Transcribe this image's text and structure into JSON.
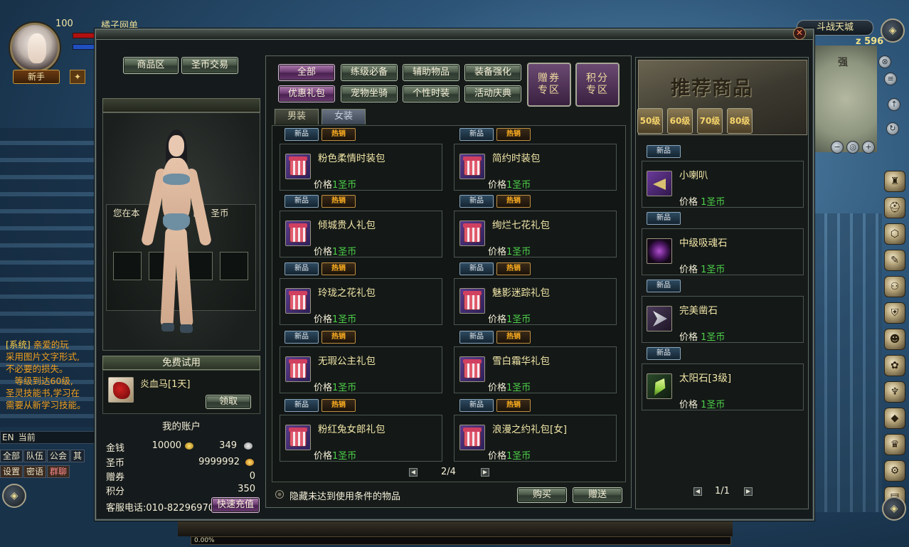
{
  "hud": {
    "level": "100",
    "player_name": "橘子网单",
    "rank_badge": "新手",
    "map_name": "斗战天城",
    "map_coord": "z 596",
    "map_marker": "强",
    "exp_percent": "0.00%"
  },
  "chat": {
    "tag": "系统",
    "lines": [
      "亲爱的玩",
      "采用图片文字形式,",
      "不必要的损失。",
      "　等级到达60级,",
      "圣灵技能书,学习在",
      "需要从新学习技能。"
    ],
    "input_mode": "EN",
    "input_label": "当前",
    "tabs_row1": [
      "全部",
      "队伍",
      "公会",
      "其"
    ],
    "tabs_row2": [
      "设置",
      "密语",
      "群聊"
    ]
  },
  "shop": {
    "left_tabs": [
      "商品区",
      "圣币交易"
    ],
    "notice_text": "您在本　　　　　　的　圣币",
    "free_trial": {
      "title": "免费试用",
      "item_name": "炎血马[1天]",
      "claim_button": "领取"
    },
    "account": {
      "title": "我的账户",
      "gold_label": "金钱",
      "gold_value": "10000",
      "silver_value": "349",
      "coin_label": "圣币",
      "coin_value": "9999992",
      "voucher_label": "赠券",
      "voucher_value": "0",
      "points_label": "积分",
      "points_value": "350",
      "hotline": "客服电话:010-82296970",
      "recharge_button": "快速充值"
    },
    "categories": [
      "全部",
      "练级必备",
      "辅助物品",
      "装备强化",
      "优惠礼包",
      "宠物坐骑",
      "个性时装",
      "活动庆典"
    ],
    "active_category": "全部",
    "zones": [
      {
        "line1": "赠券",
        "line2": "专区"
      },
      {
        "line1": "积分",
        "line2": "专区"
      }
    ],
    "subtabs": [
      "男装",
      "女装"
    ],
    "active_subtab": "女装",
    "badge_new": "新品",
    "badge_hot": "热销",
    "price_label": "价格",
    "items": [
      {
        "name": "粉色柔情时装包",
        "price": "1圣币"
      },
      {
        "name": "简约时装包",
        "price": "1圣币"
      },
      {
        "name": "倾城贵人礼包",
        "price": "1圣币"
      },
      {
        "name": "绚烂七花礼包",
        "price": "1圣币"
      },
      {
        "name": "玲珑之花礼包",
        "price": "1圣币"
      },
      {
        "name": "魅影迷踪礼包",
        "price": "1圣币"
      },
      {
        "name": "无瑕公主礼包",
        "price": "1圣币"
      },
      {
        "name": "雪白霜华礼包",
        "price": "1圣币"
      },
      {
        "name": "粉红兔女郎礼包",
        "price": "1圣币"
      },
      {
        "name": "浪漫之约礼包[女]",
        "price": "1圣币"
      }
    ],
    "page": "2/4",
    "hide_option_label": "隐藏未达到使用条件的物品",
    "buy_button": "购买",
    "gift_button": "赠送",
    "recommended": {
      "title": "推荐商品",
      "levels": [
        "50级",
        "60级",
        "70级",
        "80级"
      ],
      "items": [
        {
          "name": "小喇叭",
          "price": "1圣币",
          "icon": "horn-icon"
        },
        {
          "name": "中级吸魂石",
          "price": "1圣币",
          "icon": "orb-icon"
        },
        {
          "name": "完美凿石",
          "price": "1圣币",
          "icon": "claw-icon"
        },
        {
          "name": "太阳石[3级]",
          "price": "1圣币",
          "icon": "sun-icon"
        }
      ],
      "page": "1/1"
    }
  },
  "colors": {
    "price_green": "#4ed04a",
    "name_gold": "#f2e6a8",
    "active_purple": "#6e3e74",
    "hot_orange": "#ffb020"
  }
}
